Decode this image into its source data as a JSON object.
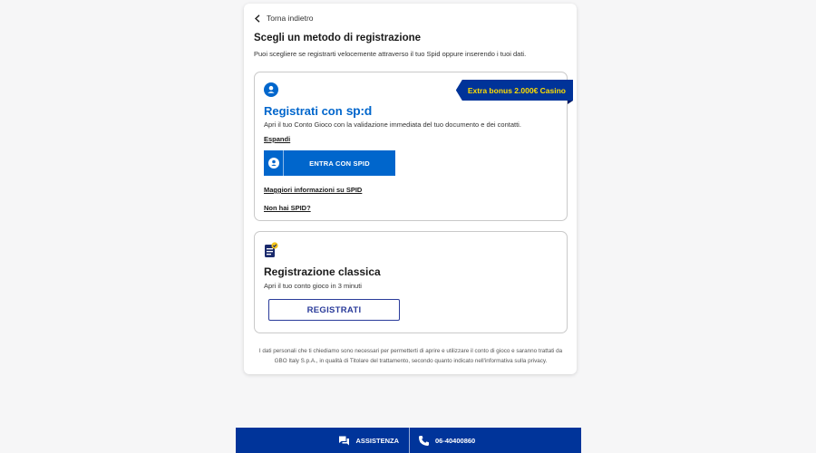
{
  "back": {
    "label": "Torna indietro"
  },
  "header": {
    "title": "Scegli un metodo di registrazione",
    "subtitle": "Puoi scegliere se registrarti velocemente attraverso il tuo Spid oppure inserendo i tuoi dati."
  },
  "spid": {
    "badge": "Extra bonus 2.000€ Casino",
    "title_prefix": "Registrati con",
    "logo_text": "sp:d",
    "description": "Apri il tuo Conto Gioco con la validazione immediata del tuo documento e dei contatti.",
    "expand_label": "Espandi",
    "button_label": "ENTRA CON SPID",
    "more_info_label": "Maggiori informazioni su SPID",
    "no_spid_label": "Non hai SPID?"
  },
  "classic": {
    "title": "Registrazione classica",
    "description": "Apri il tuo conto gioco in 3 minuti",
    "button_label": "REGISTRATI"
  },
  "privacy_text": "I dati personali che ti chiediamo sono necessari per permetterti di aprire e utilizzare il conto di gioco e saranno trattati da GBO Italy S.p.A., in qualità di Titolare del trattamento, secondo quanto indicato nell'informativa sulla privacy.",
  "footer": {
    "assistance_label": "ASSISTENZA",
    "phone": "06-40400860"
  },
  "colors": {
    "spid_blue": "#0066cc",
    "brand_navy": "#00349a",
    "badge_yellow": "#ffdd00"
  }
}
